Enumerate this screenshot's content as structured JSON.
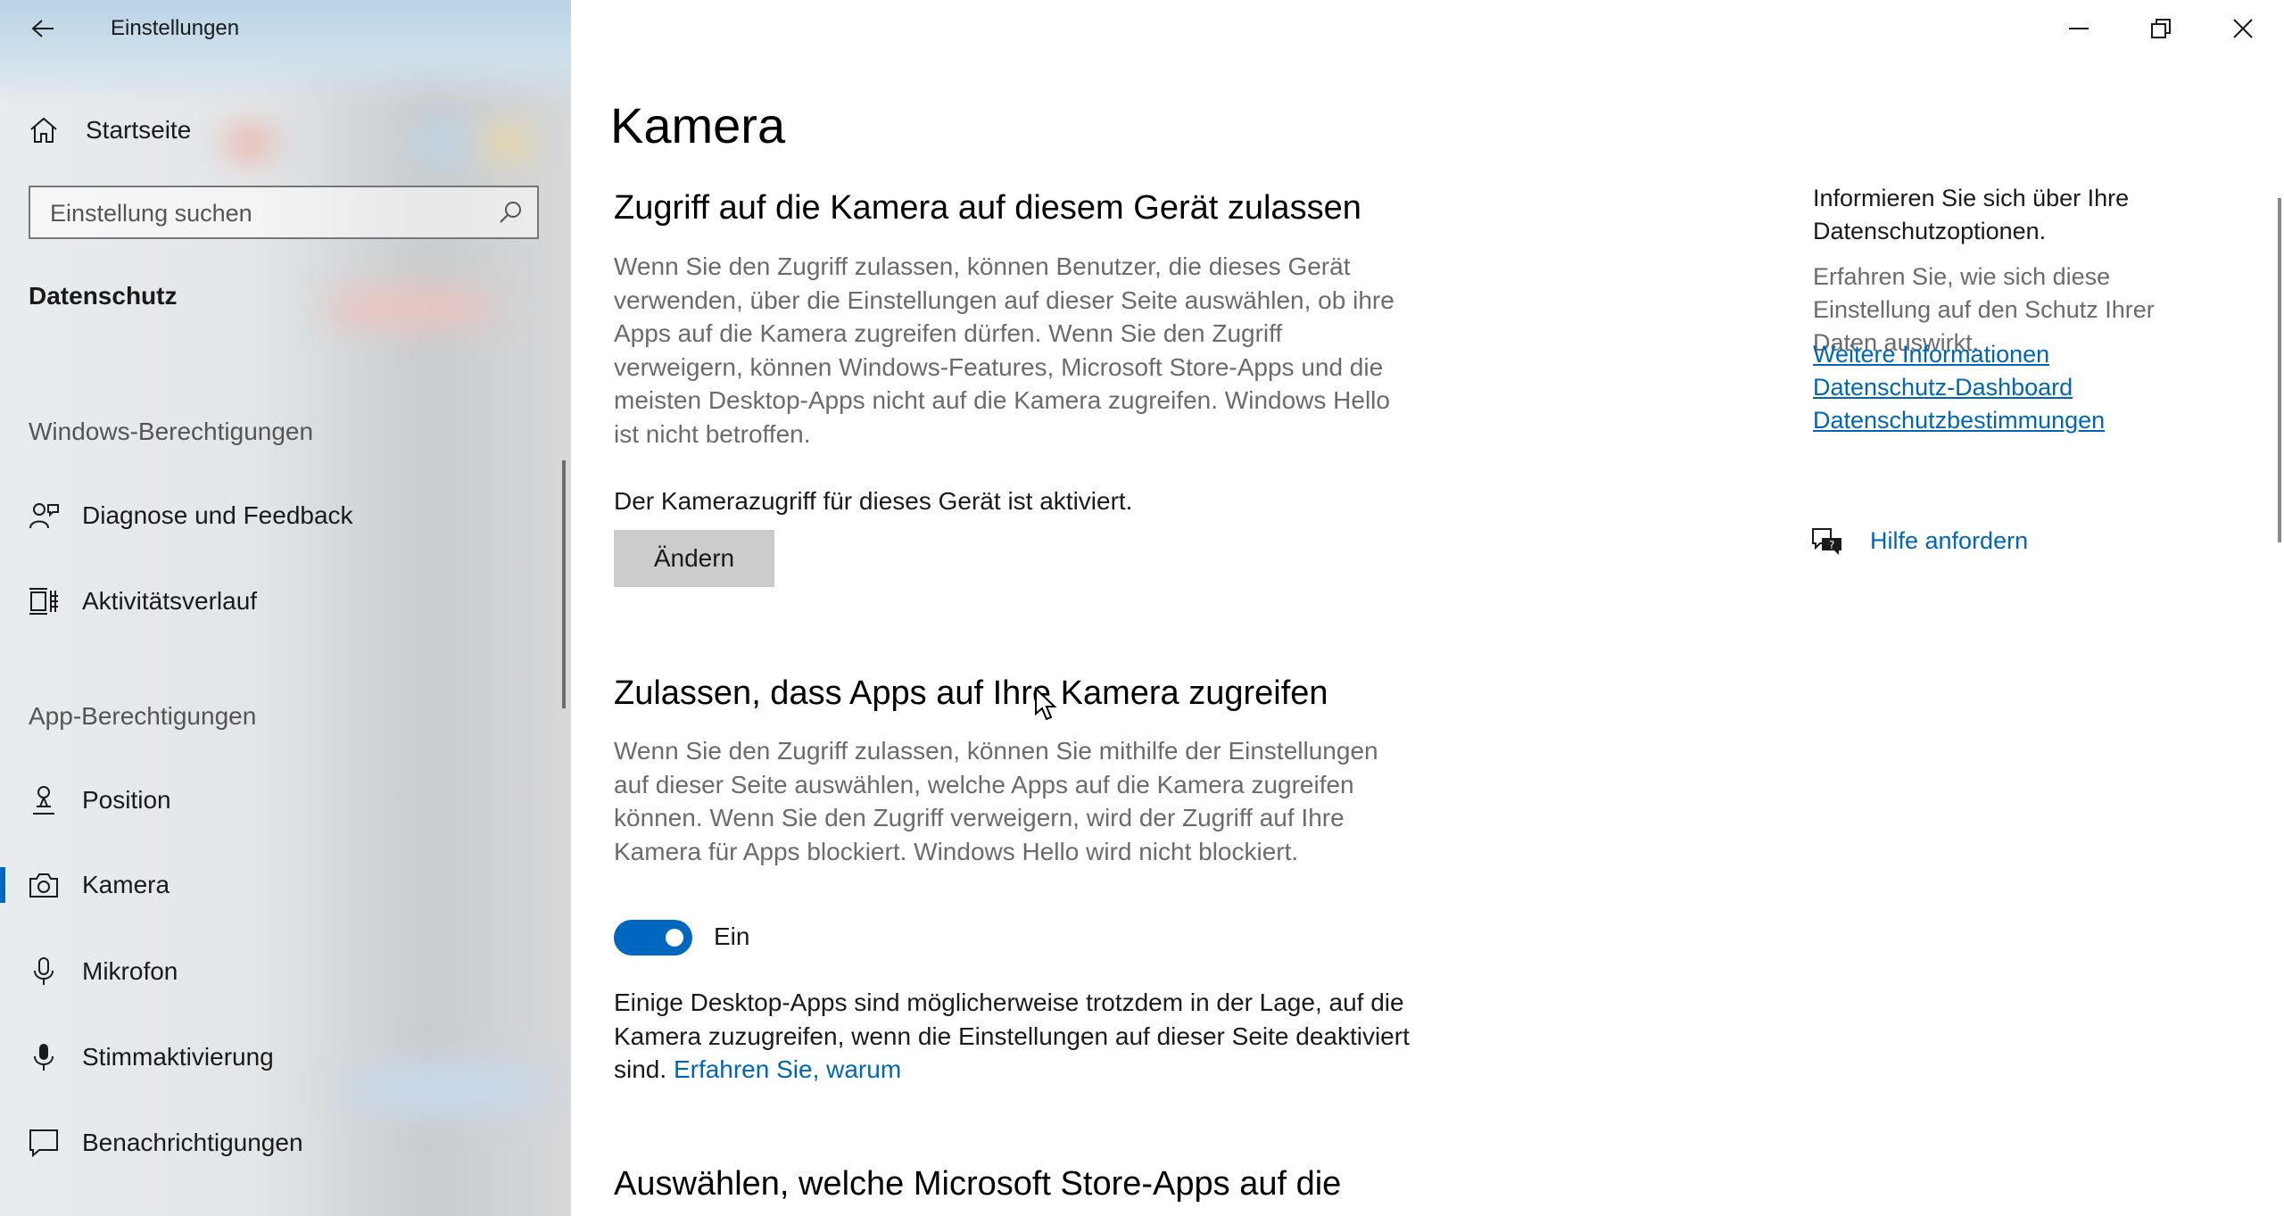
{
  "window": {
    "app_title": "Einstellungen",
    "controls": [
      "minimize-icon",
      "restore-icon",
      "close-icon"
    ]
  },
  "sidebar": {
    "home_label": "Startseite",
    "search_placeholder": "Einstellung suchen",
    "section_title": "Datenschutz",
    "groups": [
      {
        "title": "Windows-Berechtigungen",
        "items": [
          {
            "label": "Diagnose und Feedback",
            "icon": "diagnostics-feedback-icon"
          },
          {
            "label": "Aktivitätsverlauf",
            "icon": "activity-history-icon"
          }
        ]
      },
      {
        "title": "App-Berechtigungen",
        "items": [
          {
            "label": "Position",
            "icon": "location-icon"
          },
          {
            "label": "Kamera",
            "icon": "camera-icon",
            "selected": true
          },
          {
            "label": "Mikrofon",
            "icon": "microphone-icon"
          },
          {
            "label": "Stimmaktivierung",
            "icon": "voice-activation-icon"
          },
          {
            "label": "Benachrichtigungen",
            "icon": "notifications-icon"
          }
        ]
      }
    ],
    "accent_color": "#0067c0"
  },
  "main": {
    "page_title": "Kamera",
    "section1": {
      "heading": "Zugriff auf die Kamera auf diesem Gerät zulassen",
      "description": "Wenn Sie den Zugriff zulassen, können Benutzer, die dieses Gerät verwenden, über die Einstellungen auf dieser Seite auswählen, ob ihre Apps auf die Kamera zugreifen dürfen. Wenn Sie den Zugriff verweigern, können Windows-Features, Microsoft Store-Apps und die meisten Desktop-Apps nicht auf die Kamera zugreifen. Windows Hello ist nicht betroffen.",
      "status": "Der Kamerazugriff für dieses Gerät ist aktiviert.",
      "button_label": "Ändern"
    },
    "section2": {
      "heading": "Zulassen, dass Apps auf Ihre Kamera zugreifen",
      "description": "Wenn Sie den Zugriff zulassen, können Sie mithilfe der Einstellungen auf dieser Seite auswählen, welche Apps auf die Kamera zugreifen können. Wenn Sie den Zugriff verweigern, wird der Zugriff auf Ihre Kamera für Apps blockiert. Windows Hello wird nicht blockiert.",
      "toggle_state": "on",
      "toggle_label": "Ein",
      "note": "Einige Desktop-Apps sind möglicherweise trotzdem in der Lage, auf die Kamera zuzugreifen, wenn die Einstellungen auf dieser Seite deaktiviert sind.",
      "note_link": "Erfahren Sie, warum"
    },
    "section3": {
      "heading": "Auswählen, welche Microsoft Store-Apps auf die"
    }
  },
  "right_column": {
    "heading": "Informieren Sie sich über Ihre Datenschutzoptionen.",
    "body": "Erfahren Sie, wie sich diese Einstellung auf den Schutz Ihrer Daten auswirkt.",
    "links": [
      "Weitere Informationen",
      "Datenschutz-Dashboard",
      "Datenschutzbestimmungen"
    ],
    "help_label": "Hilfe anfordern",
    "link_color": "#0067b8"
  }
}
